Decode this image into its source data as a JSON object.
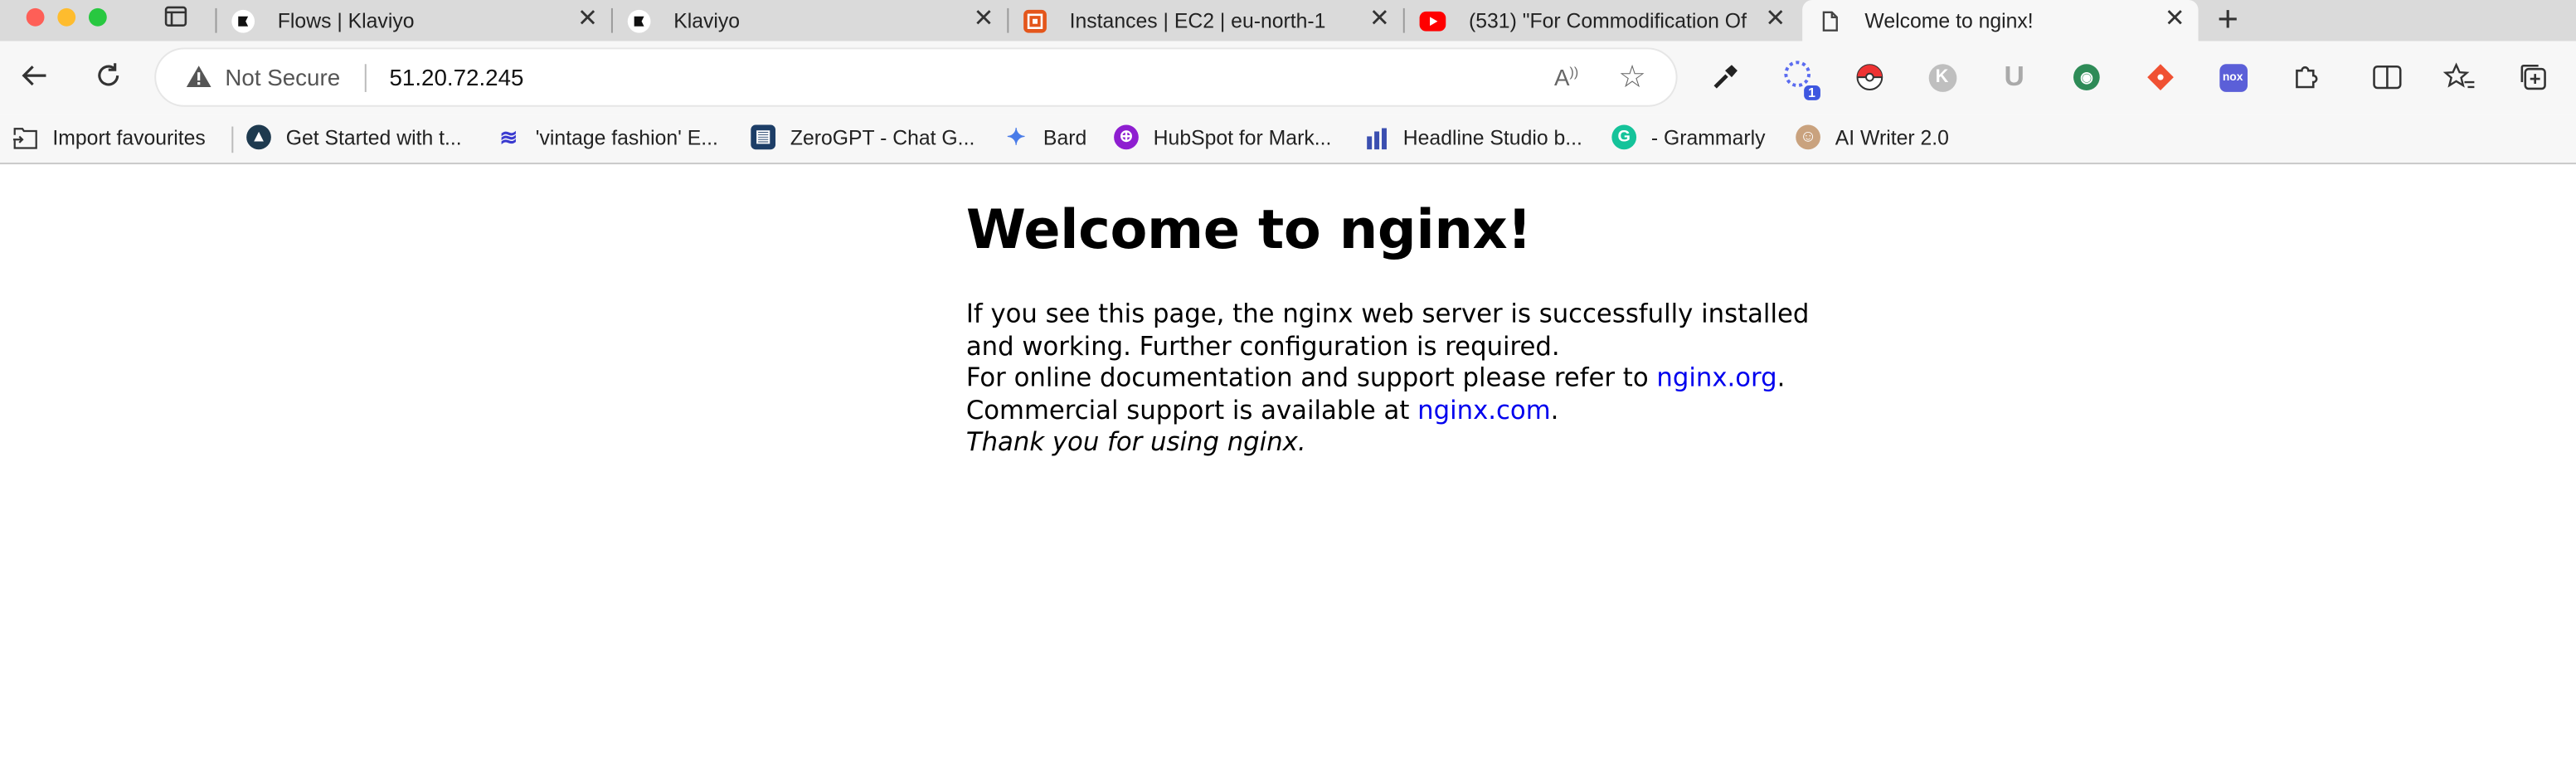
{
  "tabs": [
    {
      "title": "Flows | Klaviyo",
      "icon": "klaviyo-icon"
    },
    {
      "title": "Klaviyo",
      "icon": "klaviyo-icon"
    },
    {
      "title": "Instances | EC2 | eu-north-1",
      "icon": "aws-icon"
    },
    {
      "title": "(531) \"For Commodification Of",
      "icon": "youtube-icon"
    },
    {
      "title": "Welcome to nginx!",
      "icon": "page-icon"
    }
  ],
  "address_bar": {
    "security": "Not Secure",
    "url": "51.20.72.245"
  },
  "extension_badge": "1",
  "bookmarks": [
    {
      "label": "Import favourites",
      "icon": "import-icon"
    },
    {
      "label": "Get Started with t...",
      "icon": "mountain-icon"
    },
    {
      "label": "'vintage fashion' E...",
      "icon": "feather-icon"
    },
    {
      "label": "ZeroGPT - Chat G...",
      "icon": "book-icon"
    },
    {
      "label": "Bard",
      "icon": "sparkle-icon"
    },
    {
      "label": "HubSpot for Mark...",
      "icon": "hubspot-icon"
    },
    {
      "label": "Headline Studio b...",
      "icon": "chart-icon"
    },
    {
      "label": "- Grammarly",
      "icon": "grammarly-icon"
    },
    {
      "label": "AI Writer 2.0",
      "icon": "avatar-icon"
    }
  ],
  "page": {
    "heading": "Welcome to nginx!",
    "para1": "If you see this page, the nginx web server is successfully installed and working. Further configuration is required.",
    "para2_prefix": "For online documentation and support please refer to ",
    "para2_link": "nginx.org",
    "para2_suffix": ".",
    "para3_prefix": "Commercial support is available at ",
    "para3_link": "nginx.com",
    "para3_suffix": ".",
    "thanks": "Thank you for using nginx."
  },
  "colors": {
    "link": "#0000ee",
    "tabbar": "#dadada",
    "toolbar": "#f7f7f7"
  }
}
